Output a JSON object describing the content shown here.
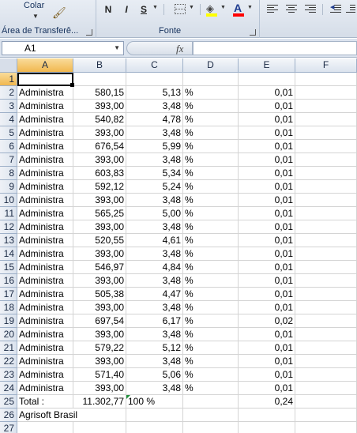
{
  "ribbon": {
    "clipboard": {
      "paste_label": "Colar",
      "group_label": "Área de Transferê..."
    },
    "font": {
      "bold_label": "N",
      "italic_label": "I",
      "underline_label": "S",
      "group_label": "Fonte",
      "fill_color": "#ffff00",
      "font_color": "#ff0000"
    }
  },
  "formula_bar": {
    "name_box": "A1",
    "fx_label": "fx",
    "formula": ""
  },
  "columns": [
    "A",
    "B",
    "C",
    "D",
    "E",
    "F"
  ],
  "selected_cell": "A1",
  "rows": [
    {
      "num": "1",
      "a": "",
      "b": "",
      "c": "",
      "d": "",
      "e": ""
    },
    {
      "num": "2",
      "a": "Administra",
      "b": "580,15",
      "c": "5,13",
      "d": "%",
      "e": "0,01"
    },
    {
      "num": "3",
      "a": "Administra",
      "b": "393,00",
      "c": "3,48",
      "d": "%",
      "e": "0,01"
    },
    {
      "num": "4",
      "a": "Administra",
      "b": "540,82",
      "c": "4,78",
      "d": "%",
      "e": "0,01"
    },
    {
      "num": "5",
      "a": "Administra",
      "b": "393,00",
      "c": "3,48",
      "d": "%",
      "e": "0,01"
    },
    {
      "num": "6",
      "a": "Administra",
      "b": "676,54",
      "c": "5,99",
      "d": "%",
      "e": "0,01"
    },
    {
      "num": "7",
      "a": "Administra",
      "b": "393,00",
      "c": "3,48",
      "d": "%",
      "e": "0,01"
    },
    {
      "num": "8",
      "a": "Administra",
      "b": "603,83",
      "c": "5,34",
      "d": "%",
      "e": "0,01"
    },
    {
      "num": "9",
      "a": "Administra",
      "b": "592,12",
      "c": "5,24",
      "d": "%",
      "e": "0,01"
    },
    {
      "num": "10",
      "a": "Administra",
      "b": "393,00",
      "c": "3,48",
      "d": "%",
      "e": "0,01"
    },
    {
      "num": "11",
      "a": "Administra",
      "b": "565,25",
      "c": "5,00",
      "d": "%",
      "e": "0,01"
    },
    {
      "num": "12",
      "a": "Administra",
      "b": "393,00",
      "c": "3,48",
      "d": "%",
      "e": "0,01"
    },
    {
      "num": "13",
      "a": "Administra",
      "b": "520,55",
      "c": "4,61",
      "d": "%",
      "e": "0,01"
    },
    {
      "num": "14",
      "a": "Administra",
      "b": "393,00",
      "c": "3,48",
      "d": "%",
      "e": "0,01"
    },
    {
      "num": "15",
      "a": "Administra",
      "b": "546,97",
      "c": "4,84",
      "d": "%",
      "e": "0,01"
    },
    {
      "num": "16",
      "a": "Administra",
      "b": "393,00",
      "c": "3,48",
      "d": "%",
      "e": "0,01"
    },
    {
      "num": "17",
      "a": "Administra",
      "b": "505,38",
      "c": "4,47",
      "d": "%",
      "e": "0,01"
    },
    {
      "num": "18",
      "a": "Administra",
      "b": "393,00",
      "c": "3,48",
      "d": "%",
      "e": "0,01"
    },
    {
      "num": "19",
      "a": "Administra",
      "b": "697,54",
      "c": "6,17",
      "d": "%",
      "e": "0,02"
    },
    {
      "num": "20",
      "a": "Administra",
      "b": "393,00",
      "c": "3,48",
      "d": "%",
      "e": "0,01"
    },
    {
      "num": "21",
      "a": "Administra",
      "b": "579,22",
      "c": "5,12",
      "d": "%",
      "e": "0,01"
    },
    {
      "num": "22",
      "a": "Administra",
      "b": "393,00",
      "c": "3,48",
      "d": "%",
      "e": "0,01"
    },
    {
      "num": "23",
      "a": "Administra",
      "b": "571,40",
      "c": "5,06",
      "d": "%",
      "e": "0,01"
    },
    {
      "num": "24",
      "a": "Administra",
      "b": "393,00",
      "c": "3,48",
      "d": "%",
      "e": "0,01"
    },
    {
      "num": "25",
      "a": "Total :",
      "b": "11.302,77",
      "c": "100 %",
      "d": "",
      "e": "0,24"
    },
    {
      "num": "26",
      "a": "Agrisoft Brasil",
      "b": "",
      "c": "",
      "d": "",
      "e": ""
    },
    {
      "num": "27",
      "a": "",
      "b": "",
      "c": "",
      "d": "",
      "e": ""
    }
  ]
}
